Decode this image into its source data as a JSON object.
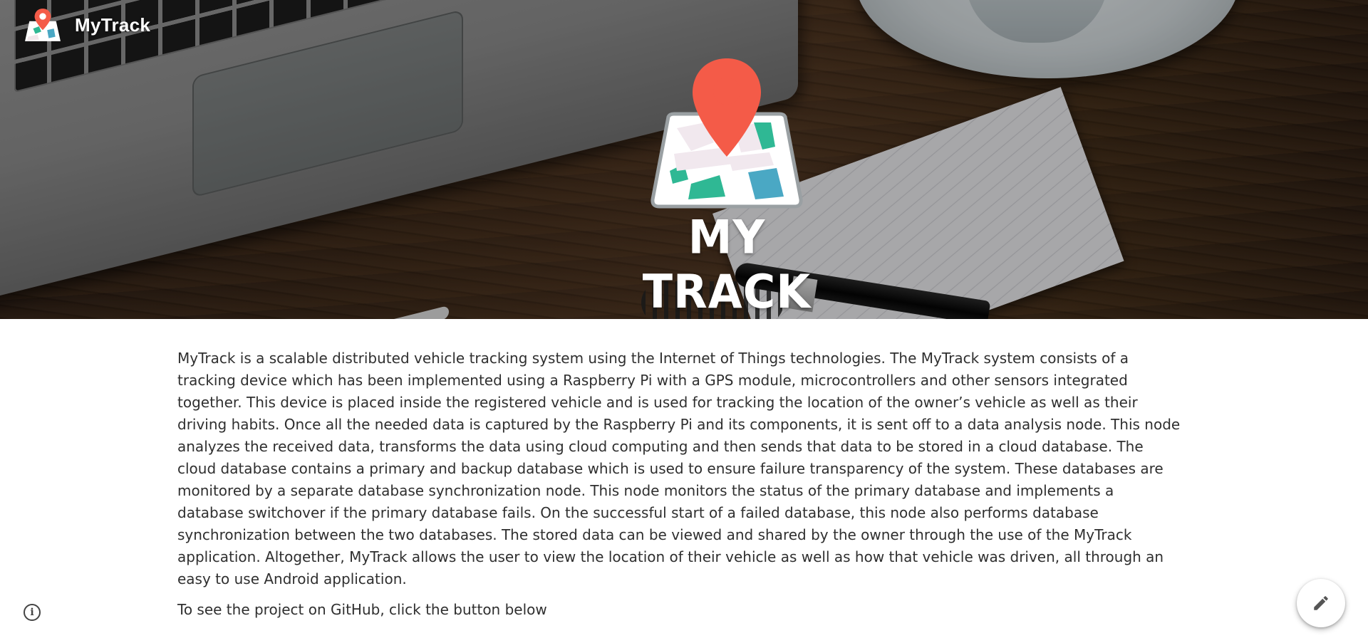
{
  "header": {
    "brand_name": "MyTrack"
  },
  "hero": {
    "title": "MY TRACK",
    "logo_icon": "map-pin-logo-icon",
    "colors": {
      "pin": "#f45b48",
      "map_green": "#2fb894",
      "map_blue": "#4aa8c4",
      "map_frame": "#ffffff"
    }
  },
  "content": {
    "description": "MyTrack is a scalable distributed vehicle tracking system using the Internet of Things technologies. The MyTrack system consists of a tracking device which has been implemented using a Raspberry Pi with a GPS module, microcontrollers and other sensors integrated together. This device is placed inside the registered vehicle and is used for tracking the location of the owner’s vehicle as well as their driving habits. Once all the needed data is captured by the Raspberry Pi and its components, it is sent off to a data analysis node. This node analyzes the received data, transforms the data using cloud computing and then sends that data to be stored in a cloud database. The cloud database contains a primary and backup database which is used to ensure failure transparency of the system. These databases are monitored by a separate database synchronization node. This node monitors the status of the primary database and implements a database switchover if the primary database fails. On the successful start of a failed database, this node also performs database synchronization between the two databases. The stored data can be viewed and shared by the owner through the use of the MyTrack application. Altogether, MyTrack allows the user to view the location of their vehicle as well as how that vehicle was driven, all through an easy to use Android application.",
    "github_note": "To see the project on GitHub, click the button below"
  },
  "controls": {
    "info_icon": "info-icon",
    "info_glyph": "i",
    "edit_icon": "pencil-icon"
  }
}
